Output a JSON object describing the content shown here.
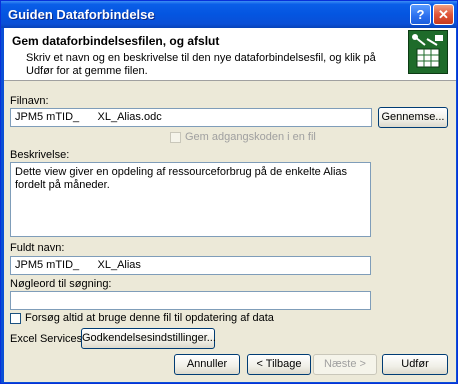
{
  "window": {
    "title": "Guiden Dataforbindelse",
    "help_glyph": "?",
    "close_glyph": "✕"
  },
  "header": {
    "title": "Gem dataforbindelsesfilen, og afslut",
    "description": "Skriv et navn og en beskrivelse til den nye dataforbindelsesfil, og klik på Udfør for at gemme filen.",
    "icon": "data-connection-icon"
  },
  "form": {
    "filename": {
      "label": "Filnavn:",
      "value": "JPM5 mTID_      XL_Alias.odc"
    },
    "browse_button": "Gennemse...",
    "save_password": {
      "label": "Gem adgangskoden i en fil",
      "checked": false,
      "disabled": true
    },
    "description": {
      "label": "Beskrivelse:",
      "value": "Dette view giver en opdeling af ressourceforbrug på de enkelte Alias fordelt på måneder."
    },
    "friendly_name": {
      "label": "Fuldt navn:",
      "value": "JPM5 mTID_      XL_Alias"
    },
    "keywords": {
      "label": "Nøgleord til søgning:",
      "value": ""
    },
    "always_use": {
      "label": "Forsøg altid at bruge denne fil til opdatering af data",
      "checked": false
    },
    "excel_services": {
      "label": "Excel Services:",
      "button": "Godkendelsesindstillinger..."
    }
  },
  "footer": {
    "cancel": "Annuller",
    "back": "< Tilbage",
    "next": "Næste >",
    "finish": "Udfør"
  }
}
